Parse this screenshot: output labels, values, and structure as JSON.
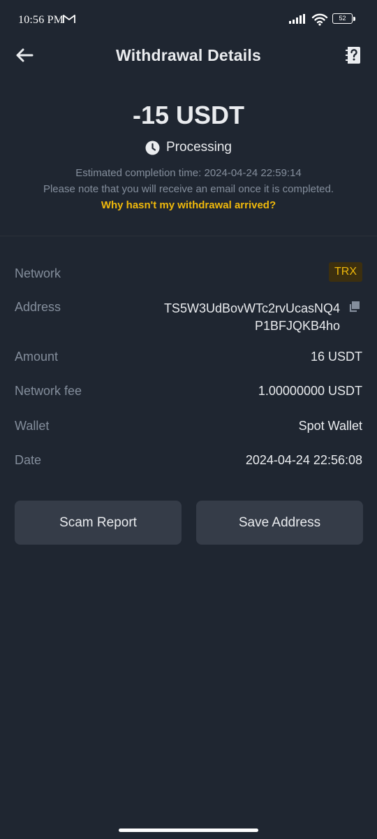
{
  "status_bar": {
    "time": "10:56 PM",
    "battery_level": "52"
  },
  "header": {
    "title": "Withdrawal Details"
  },
  "summary": {
    "amount": "-15 USDT",
    "status": "Processing",
    "estimated_completion": "Estimated completion time: 2024-04-24 22:59:14",
    "email_note": "Please note that you will receive an email once it is completed.",
    "help_link": "Why hasn't my withdrawal arrived?"
  },
  "details": {
    "network_label": "Network",
    "network_value": "TRX",
    "address_label": "Address",
    "address_line_1": "TS5W3UdBovWTc2rvUcasNQ4",
    "address_line_2": "P1BFJQKB4ho",
    "amount_label": "Amount",
    "amount_value": "16 USDT",
    "fee_label": "Network fee",
    "fee_value": "1.00000000 USDT",
    "wallet_label": "Wallet",
    "wallet_value": "Spot Wallet",
    "date_label": "Date",
    "date_value": "2024-04-24 22:56:08"
  },
  "actions": {
    "scam_report": "Scam Report",
    "save_address": "Save Address"
  },
  "colors": {
    "background": "#1f2631",
    "accent": "#f0b90b",
    "muted_text": "#848e9c",
    "button_bg": "#353c48"
  }
}
